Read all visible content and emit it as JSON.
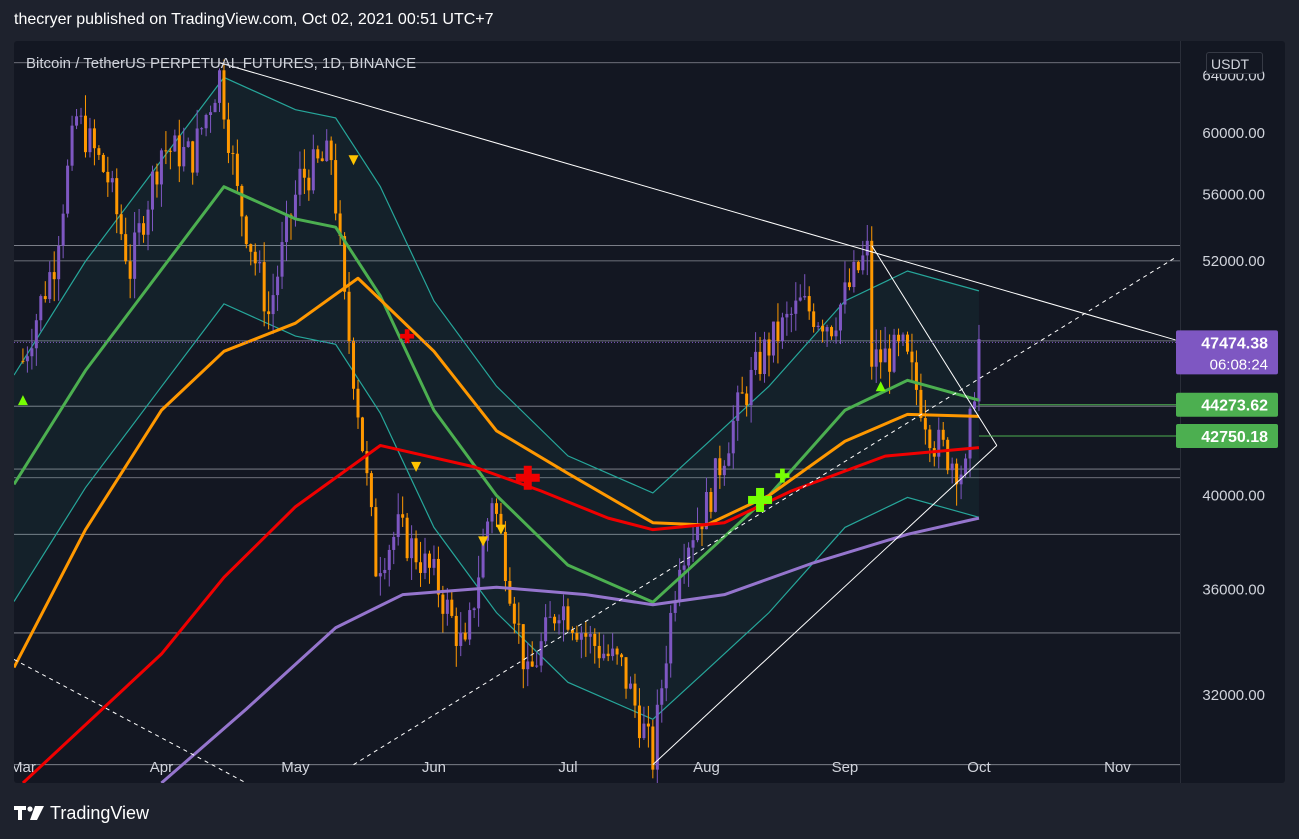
{
  "header": {
    "publisher_line": "thecryer published on TradingView.com, Oct 02, 2021 00:51 UTC+7"
  },
  "chart_header": {
    "title": "Bitcoin / TetherUS PERPETUAL FUTURES, 1D, BINANCE",
    "currency": "USDT"
  },
  "footer": {
    "brand": "TradingView"
  },
  "colors": {
    "background": "#131722",
    "page": "#1e222d",
    "candle_up": "#7e57c2",
    "candle_down": "#ff9800",
    "ma_green": "#4caf50",
    "ma_orange": "#ff9800",
    "ma_red": "#f00000",
    "ma_purple": "#9575cd",
    "bollinger": "#26a69a",
    "trendline": "#ffffff",
    "last_price_tag": "#7e57c2",
    "level_tag": "#4caf50"
  },
  "chart_data": {
    "type": "candlestick",
    "title": "Bitcoin / TetherUS PERPETUAL FUTURES, 1D, BINANCE",
    "currency": "USDT",
    "x_tick_labels": [
      "Mar",
      "Apr",
      "May",
      "Jun",
      "Jul",
      "Aug",
      "Sep",
      "Oct",
      "Nov"
    ],
    "y_tick_labels": [
      "64000.00",
      "60000.00",
      "56000.00",
      "52000.00",
      "40000.00",
      "36000.00",
      "32000.00"
    ],
    "y_ticks": [
      64000,
      60000,
      56000,
      52000,
      40000,
      36000,
      32000
    ],
    "ylim": [
      29000,
      66500
    ],
    "y_scale": "log",
    "xlim": [
      "2021-02-27",
      "2021-11-15"
    ],
    "last_price": {
      "value": "47474.38",
      "countdown": "06:08:24"
    },
    "price_levels": [
      {
        "label": "44273.62",
        "value": 44273.62
      },
      {
        "label": "42750.18",
        "value": 42750.18
      }
    ],
    "horizontal_lines": [
      64900,
      52900,
      52000,
      47550,
      44200,
      41200,
      40800,
      38300,
      34300,
      29600
    ],
    "series": [
      {
        "name": "price",
        "type": "candlestick",
        "points": [
          [
            "2021-03-01",
            46500
          ],
          [
            "2021-03-08",
            52000
          ],
          [
            "2021-03-13",
            61000
          ],
          [
            "2021-03-20",
            57000
          ],
          [
            "2021-03-25",
            51500
          ],
          [
            "2021-04-01",
            59000
          ],
          [
            "2021-04-08",
            58500
          ],
          [
            "2021-04-14",
            64000
          ],
          [
            "2021-04-18",
            56000
          ],
          [
            "2021-04-25",
            49000
          ],
          [
            "2021-05-02",
            57000
          ],
          [
            "2021-05-09",
            58500
          ],
          [
            "2021-05-12",
            49500
          ],
          [
            "2021-05-19",
            37000
          ],
          [
            "2021-05-24",
            38500
          ],
          [
            "2021-06-01",
            36500
          ],
          [
            "2021-06-08",
            33500
          ],
          [
            "2021-06-14",
            40000
          ],
          [
            "2021-06-22",
            32500
          ],
          [
            "2021-06-29",
            35500
          ],
          [
            "2021-07-06",
            34000
          ],
          [
            "2021-07-13",
            33000
          ],
          [
            "2021-07-20",
            29800
          ],
          [
            "2021-07-26",
            37500
          ],
          [
            "2021-08-01",
            39500
          ],
          [
            "2021-08-08",
            44000
          ],
          [
            "2021-08-14",
            47000
          ],
          [
            "2021-08-22",
            49500
          ],
          [
            "2021-08-29",
            48500
          ],
          [
            "2021-09-06",
            52500
          ],
          [
            "2021-09-07",
            46500
          ],
          [
            "2021-09-14",
            47000
          ],
          [
            "2021-09-21",
            42500
          ],
          [
            "2021-09-28",
            41000
          ],
          [
            "2021-10-01",
            47474.38
          ]
        ]
      },
      {
        "name": "MA green",
        "type": "line",
        "points": [
          [
            "2021-02-27",
            40500
          ],
          [
            "2021-03-15",
            46000
          ],
          [
            "2021-04-01",
            51500
          ],
          [
            "2021-04-15",
            56500
          ],
          [
            "2021-05-01",
            54500
          ],
          [
            "2021-05-10",
            54000
          ],
          [
            "2021-05-20",
            50000
          ],
          [
            "2021-06-01",
            44000
          ],
          [
            "2021-06-15",
            40000
          ],
          [
            "2021-07-01",
            37000
          ],
          [
            "2021-07-20",
            35500
          ],
          [
            "2021-08-01",
            37500
          ],
          [
            "2021-08-15",
            40000
          ],
          [
            "2021-09-01",
            44000
          ],
          [
            "2021-09-15",
            45500
          ],
          [
            "2021-10-01",
            44500
          ]
        ]
      },
      {
        "name": "MA orange",
        "type": "line",
        "points": [
          [
            "2021-02-27",
            33000
          ],
          [
            "2021-03-15",
            38500
          ],
          [
            "2021-04-01",
            44000
          ],
          [
            "2021-04-15",
            47000
          ],
          [
            "2021-05-01",
            48500
          ],
          [
            "2021-05-15",
            51000
          ],
          [
            "2021-06-01",
            47000
          ],
          [
            "2021-06-15",
            43000
          ],
          [
            "2021-07-01",
            41000
          ],
          [
            "2021-07-20",
            38800
          ],
          [
            "2021-08-01",
            38700
          ],
          [
            "2021-08-15",
            40000
          ],
          [
            "2021-09-01",
            42500
          ],
          [
            "2021-09-15",
            43800
          ],
          [
            "2021-10-01",
            43700
          ]
        ]
      },
      {
        "name": "MA red",
        "type": "line",
        "points": [
          [
            "2021-03-01",
            29000
          ],
          [
            "2021-04-01",
            33500
          ],
          [
            "2021-04-15",
            36500
          ],
          [
            "2021-05-01",
            39500
          ],
          [
            "2021-05-20",
            42300
          ],
          [
            "2021-06-10",
            41300
          ],
          [
            "2021-06-25",
            40200
          ],
          [
            "2021-07-10",
            39000
          ],
          [
            "2021-07-20",
            38500
          ],
          [
            "2021-08-05",
            38800
          ],
          [
            "2021-08-20",
            40200
          ],
          [
            "2021-09-10",
            41800
          ],
          [
            "2021-10-01",
            42200
          ]
        ]
      },
      {
        "name": "MA purple",
        "type": "line",
        "points": [
          [
            "2021-04-01",
            29000
          ],
          [
            "2021-04-20",
            31500
          ],
          [
            "2021-05-10",
            34500
          ],
          [
            "2021-05-25",
            35800
          ],
          [
            "2021-06-15",
            36100
          ],
          [
            "2021-07-05",
            35800
          ],
          [
            "2021-07-20",
            35400
          ],
          [
            "2021-08-05",
            35800
          ],
          [
            "2021-08-25",
            37100
          ],
          [
            "2021-09-15",
            38300
          ],
          [
            "2021-10-01",
            39000
          ]
        ]
      }
    ],
    "markers": [
      {
        "type": "cross",
        "color": "#f00000",
        "date": "2021-05-26",
        "value": 47800
      },
      {
        "type": "cross",
        "color": "#f00000",
        "date": "2021-06-22",
        "value": 40800
      },
      {
        "type": "cross",
        "color": "#76ff03",
        "date": "2021-08-13",
        "value": 39800
      },
      {
        "type": "cross",
        "color": "#76ff03",
        "date": "2021-08-18",
        "value": 40900
      }
    ],
    "grid": false,
    "legend": "none"
  }
}
